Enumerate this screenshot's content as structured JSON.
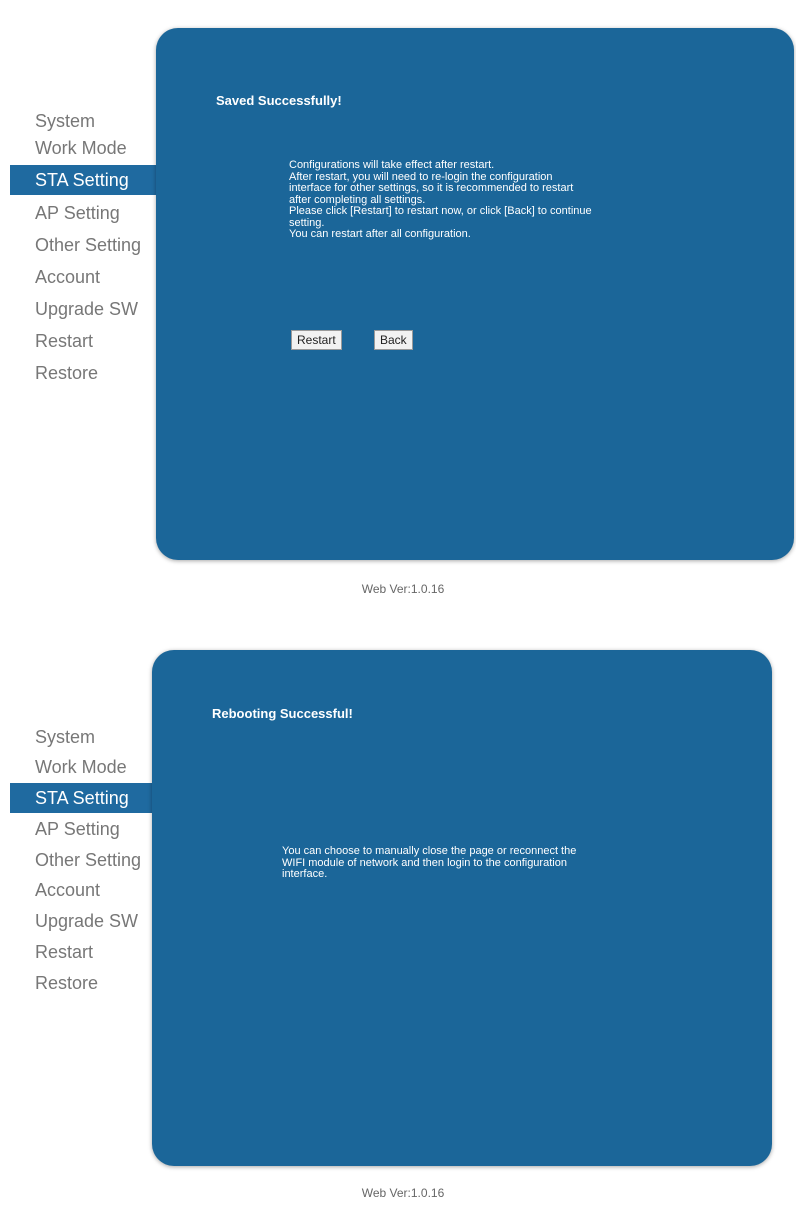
{
  "saved_screen": {
    "nav": [
      "System",
      "Work Mode",
      "STA Setting",
      "AP Setting",
      "Other Setting",
      "Account",
      "Upgrade SW",
      "Restart",
      "Restore"
    ],
    "active_nav": "STA Setting",
    "title": "Saved Successfully!",
    "message_lines": [
      "Configurations will take effect after restart.",
      "After restart, you will need to re-login the configuration",
      "interface for other settings, so it is recommended to restart",
      "after completing all settings.",
      "Please click [Restart] to restart now, or click [Back] to continue",
      "setting.",
      "You can restart after all configuration."
    ],
    "restart_button": "Restart",
    "back_button": "Back",
    "footer": "Web Ver:1.0.16"
  },
  "reboot_screen": {
    "nav": [
      "System",
      "Work Mode",
      "STA Setting",
      "AP Setting",
      "Other Setting",
      "Account",
      "Upgrade SW",
      "Restart",
      "Restore"
    ],
    "active_nav": "STA Setting",
    "title": "Rebooting Successful!",
    "message_lines": [
      "You can choose to manually close the page or reconnect the",
      "WIFI module of network and then login to the configuration",
      "interface."
    ],
    "footer": "Web Ver:1.0.16"
  },
  "colors": {
    "panel": "#1b6699",
    "active_nav": "#1f6aa0",
    "nav_text": "#777777"
  }
}
